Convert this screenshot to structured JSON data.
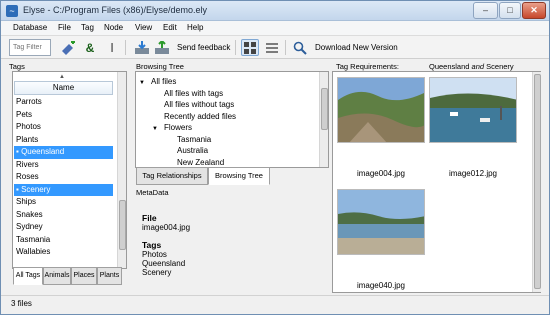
{
  "window": {
    "title": "Elyse - C:/Program Files (x86)/Elyse/demo.ely",
    "minimize": "–",
    "maximize": "□",
    "close": "✕"
  },
  "menu": [
    "Database",
    "File",
    "Tag",
    "Node",
    "View",
    "Edit",
    "Help"
  ],
  "toolbar": {
    "tag_filter_placeholder": "Tag Filter",
    "send_feedback": "Send feedback",
    "download_new_version": "Download New Version"
  },
  "tags_panel": {
    "title": "Tags",
    "column_header": "Name",
    "items": [
      {
        "label": "Parrots",
        "selected": false
      },
      {
        "label": "Pets",
        "selected": false
      },
      {
        "label": "Photos",
        "selected": false
      },
      {
        "label": "Plants",
        "selected": false
      },
      {
        "label": "Queensland",
        "selected": true
      },
      {
        "label": "Rivers",
        "selected": false
      },
      {
        "label": "Roses",
        "selected": false
      },
      {
        "label": "Scenery",
        "selected": true
      },
      {
        "label": "Ships",
        "selected": false
      },
      {
        "label": "Snakes",
        "selected": false
      },
      {
        "label": "Sydney",
        "selected": false
      },
      {
        "label": "Tasmania",
        "selected": false
      },
      {
        "label": "Wallabies",
        "selected": false
      }
    ],
    "tabs": [
      {
        "label": "All Tags",
        "active": true
      },
      {
        "label": "Animals",
        "active": false
      },
      {
        "label": "Places",
        "active": false
      },
      {
        "label": "Plants",
        "active": false
      }
    ]
  },
  "browsing_tree": {
    "title": "Browsing Tree",
    "rows": [
      {
        "label": "All files",
        "level": 0,
        "expander": "▼"
      },
      {
        "label": "All files with tags",
        "level": 1,
        "expander": ""
      },
      {
        "label": "All files without tags",
        "level": 1,
        "expander": ""
      },
      {
        "label": "Recently added files",
        "level": 1,
        "expander": ""
      },
      {
        "label": "Flowers",
        "level": 1,
        "expander": "▼"
      },
      {
        "label": "Tasmania",
        "level": 2,
        "expander": ""
      },
      {
        "label": "Australia",
        "level": 2,
        "expander": ""
      },
      {
        "label": "New Zealand",
        "level": 2,
        "expander": ""
      }
    ],
    "tabs": [
      {
        "label": "Tag Relationships",
        "active": false
      },
      {
        "label": "Browsing Tree",
        "active": true
      }
    ]
  },
  "metadata": {
    "title": "MetaData",
    "file_heading": "File",
    "file_value": "image004.jpg",
    "tags_heading": "Tags",
    "tags": [
      "Photos",
      "Queensland",
      "Scenery"
    ]
  },
  "requirements": {
    "label": "Tag Requirements:",
    "part1": "Queensland",
    "conj": "and",
    "part2": "Scenery"
  },
  "files": [
    {
      "name": "image004.jpg"
    },
    {
      "name": "image012.jpg"
    },
    {
      "name": "image040.jpg"
    }
  ],
  "status": {
    "text": "3 files"
  },
  "colors": {
    "selection": "#3399ff",
    "accent": "#2e6db8"
  }
}
